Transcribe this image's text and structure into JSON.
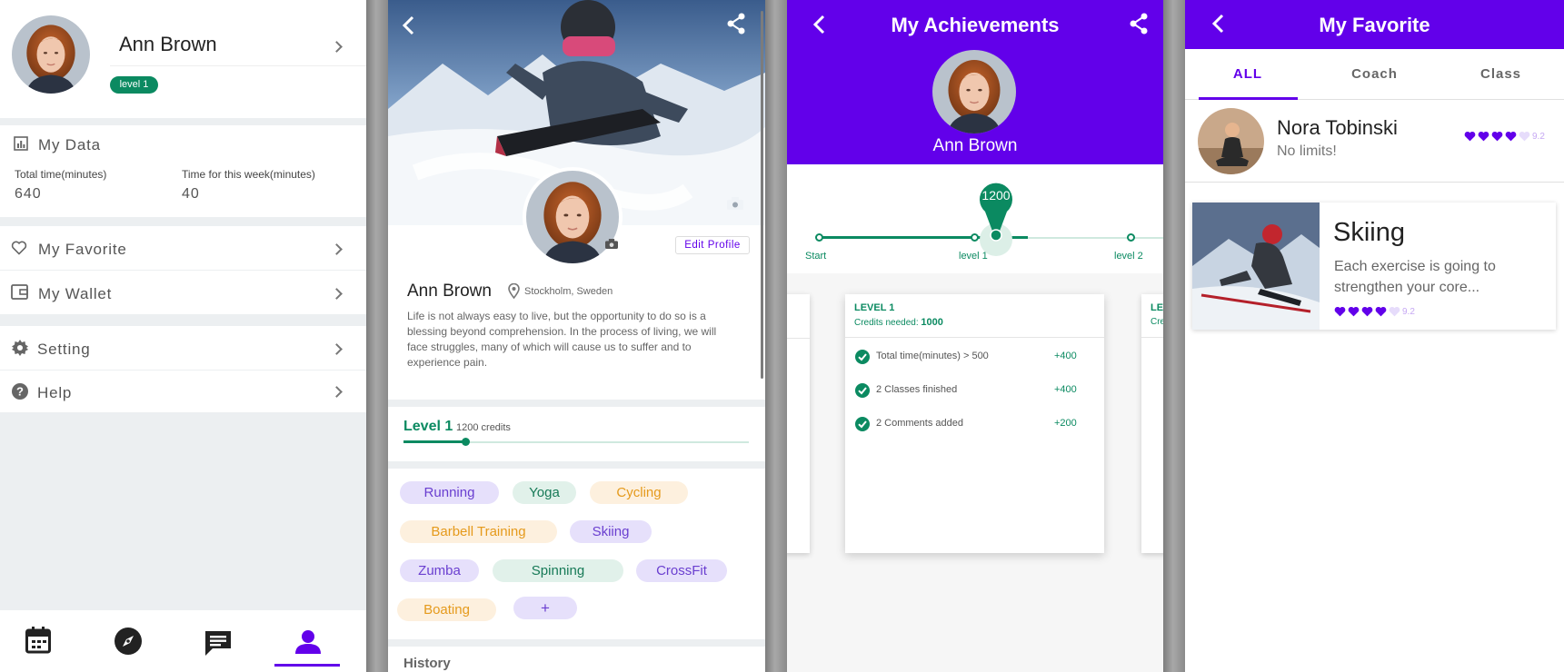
{
  "profile_menu": {
    "user_name": "Ann Brown",
    "level_badge": "level 1",
    "my_data": {
      "title": "My Data",
      "total_label": "Total time(minutes)",
      "total_value": "640",
      "week_label": "Time for this week(minutes)",
      "week_value": "40"
    },
    "items": {
      "favorite": "My Favorite",
      "wallet": "My Wallet",
      "setting": "Setting",
      "help": "Help"
    },
    "bottom_nav": [
      "calendar-icon",
      "compass-icon",
      "chat-icon",
      "person-icon"
    ],
    "active_nav": "person-icon"
  },
  "profile_detail": {
    "edit_button": "Edit Profile",
    "user_name": "Ann Brown",
    "location": "Stockholm, Sweden",
    "bio": "Life is not always easy to live, but the opportunity to do so is a blessing beyond comprehension. In the process of living, we will face struggles, many of which will cause us to suffer and to experience pain.",
    "level_label": "Level 1",
    "credits_label": "1200 credits",
    "level_progress": 0.18,
    "tags": {
      "running": "Running",
      "yoga": "Yoga",
      "cycling": "Cycling",
      "barbell": "Barbell Training",
      "skiing": "Skiing",
      "zumba": "Zumba",
      "spinning": "Spinning",
      "crossfit": "CrossFit",
      "boating": "Boating",
      "add": "+"
    },
    "history_label": "History"
  },
  "achievements": {
    "title": "My Achievements",
    "user_name": "Ann Brown",
    "current_credits": "1200",
    "milestones": {
      "start": "Start",
      "level1": "level 1",
      "level2": "level 2"
    },
    "level_card": {
      "title": "LEVEL 1",
      "credits_prefix": "Credits needed:",
      "credits_value": "1000",
      "tasks": [
        {
          "label": "Total time(minutes) > 500",
          "points": "+400"
        },
        {
          "label": "2 Classes finished",
          "points": "+400"
        },
        {
          "label": "2 Comments added",
          "points": "+200"
        }
      ]
    },
    "next_card_title": "LE",
    "next_card_credits": "Cre"
  },
  "favorite": {
    "title": "My Favorite",
    "tabs": [
      "ALL",
      "Coach",
      "Class"
    ],
    "active_tab": "ALL",
    "coach": {
      "name": "Nora Tobinski",
      "subtitle": "No limits!",
      "hearts_filled": 4,
      "hearts_total": 5,
      "rating": "9.2"
    },
    "class": {
      "title": "Skiing",
      "description": "Each exercise is going to strengthen your core...",
      "hearts_filled": 4,
      "hearts_total": 5,
      "rating": "9.2"
    }
  },
  "colors": {
    "purple": "#6200ea",
    "green": "#0b8a61",
    "divider_gray": "#eceff1"
  }
}
